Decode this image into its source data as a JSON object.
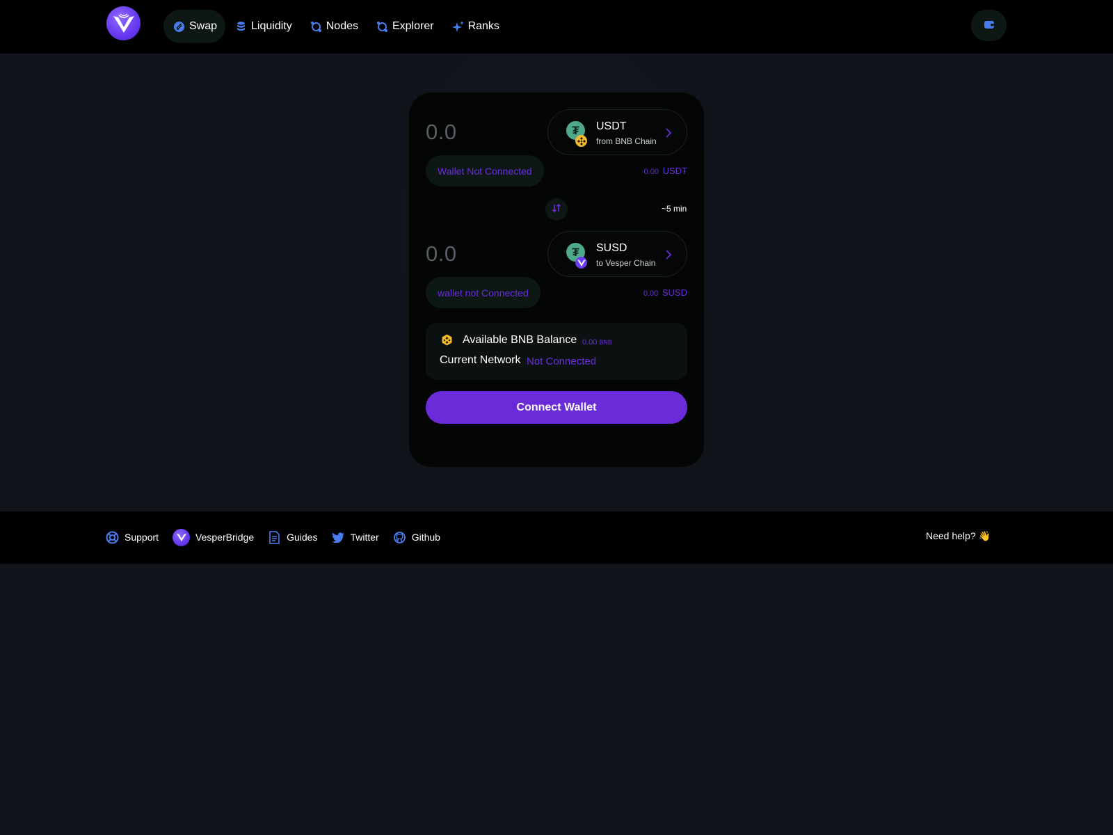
{
  "header": {
    "nav": [
      {
        "label": "Swap",
        "icon": "swap-icon",
        "active": true
      },
      {
        "label": "Liquidity",
        "icon": "database-icon",
        "active": false
      },
      {
        "label": "Nodes",
        "icon": "nodes-icon",
        "active": false
      },
      {
        "label": "Explorer",
        "icon": "explorer-icon",
        "active": false
      },
      {
        "label": "Ranks",
        "icon": "sparkle-icon",
        "active": false
      }
    ],
    "wallet_icon": "wallet-icon"
  },
  "swap": {
    "from": {
      "amount": "0.0",
      "symbol": "USDT",
      "chain": "from BNB Chain",
      "wallet_status": "Wallet Not Connected",
      "balance_value": "0.00",
      "balance_symbol": "USDT"
    },
    "to": {
      "amount": "0.0",
      "symbol": "SUSD",
      "chain": "to Vesper Chain",
      "wallet_status": "wallet not Connected",
      "balance_value": "0.00",
      "balance_symbol": "SUSD"
    },
    "eta": "~5 min",
    "info": {
      "balance_label": "Available BNB Balance",
      "balance_value": "0.00",
      "balance_unit": "BNB",
      "network_label": "Current Network",
      "network_value": "Not Connected"
    },
    "connect_label": "Connect Wallet"
  },
  "footer": {
    "links": [
      {
        "label": "Support",
        "icon": "lifebuoy-icon"
      },
      {
        "label": "VesperBridge",
        "icon": "vesper-logo-icon"
      },
      {
        "label": "Guides",
        "icon": "document-icon"
      },
      {
        "label": "Twitter",
        "icon": "twitter-icon"
      },
      {
        "label": "Github",
        "icon": "github-icon"
      }
    ],
    "help": "Need help? 👋"
  },
  "colors": {
    "accent": "#6a2bd8",
    "nav_icon": "#4a7cf0",
    "background": "#11141b"
  }
}
